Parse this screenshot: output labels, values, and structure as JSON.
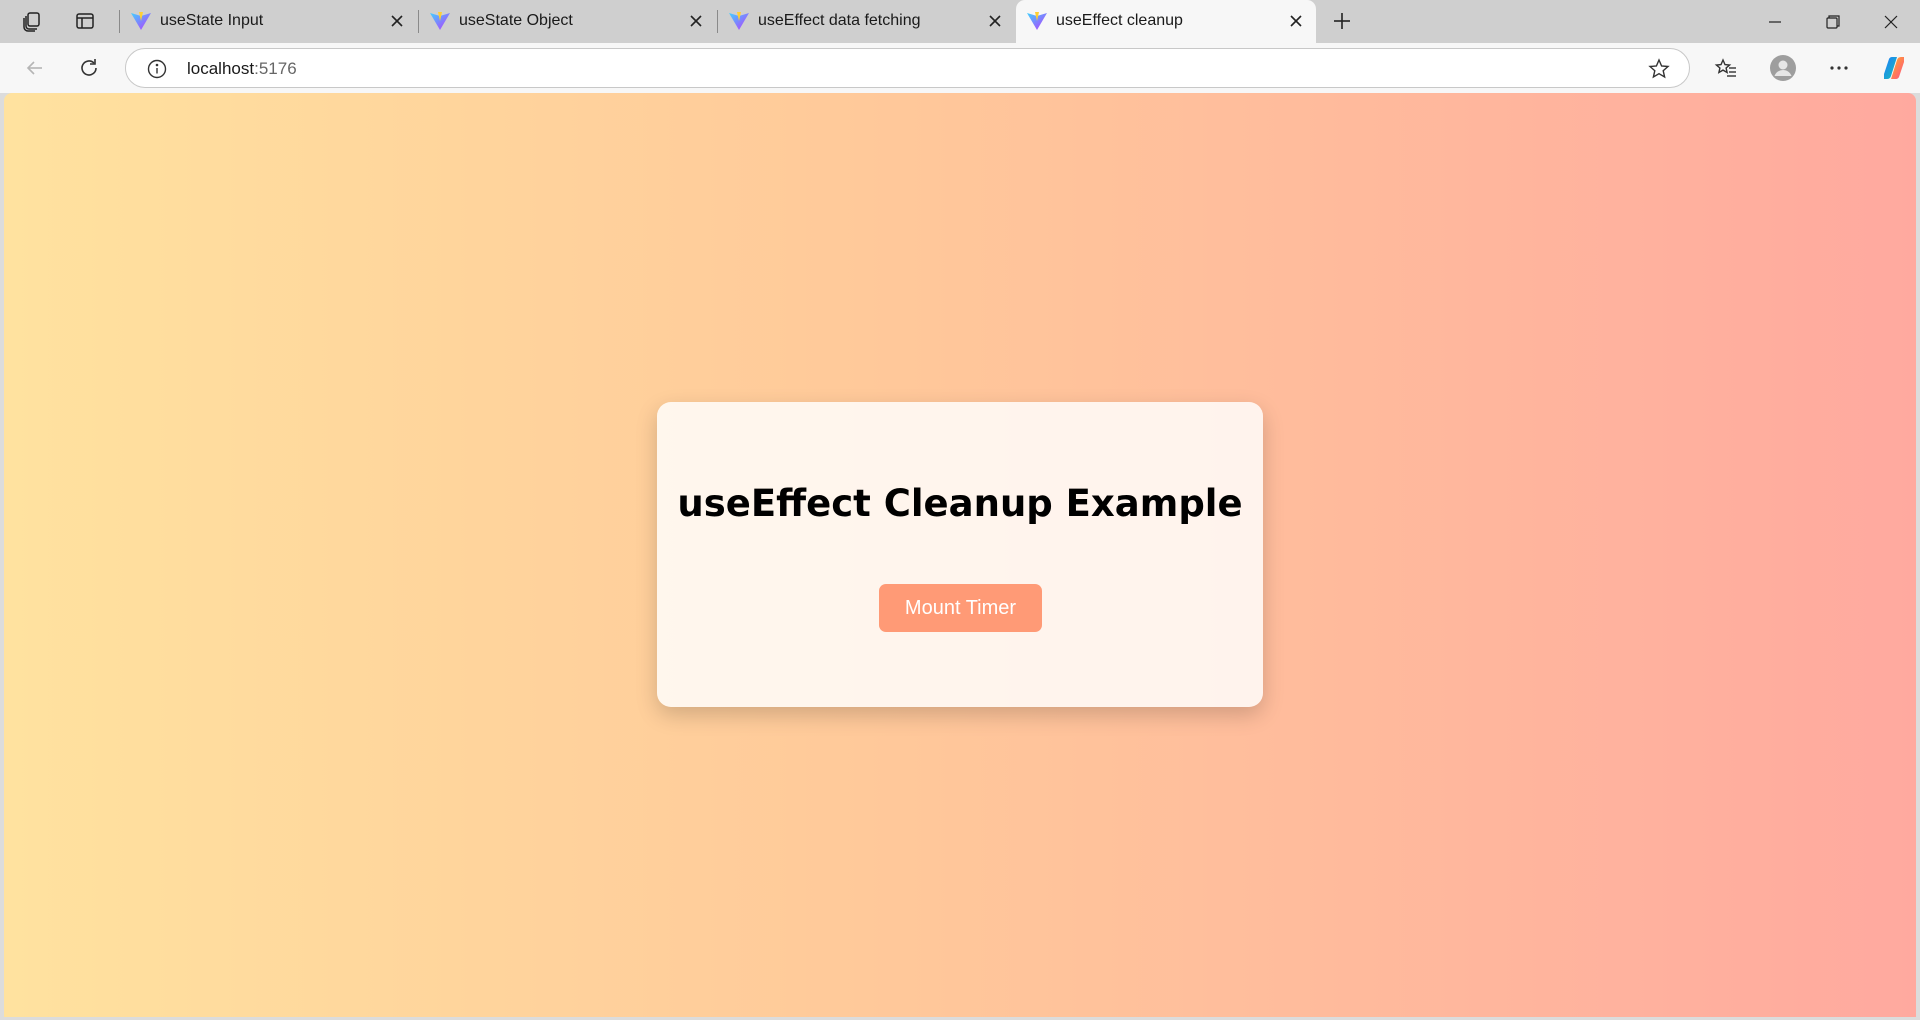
{
  "browser": {
    "tabs": [
      {
        "label": "useState Input",
        "active": false
      },
      {
        "label": "useState Object",
        "active": false
      },
      {
        "label": "useEffect data fetching",
        "active": false
      },
      {
        "label": "useEffect cleanup",
        "active": true
      }
    ],
    "address": {
      "host": "localhost",
      "port": ":5176"
    }
  },
  "page": {
    "heading": "useEffect Cleanup Example",
    "mount_button_label": "Mount Timer"
  },
  "colors": {
    "gradient_start": "#ffe29f",
    "gradient_end": "#ffa99f",
    "button_bg": "#ff9a76",
    "button_text": "#ffffff"
  },
  "icons": [
    "workspaces-icon",
    "tab-actions-icon",
    "vite-favicon-icon",
    "close-icon",
    "new-tab-icon",
    "minimize-icon",
    "restore-icon",
    "window-close-icon",
    "back-icon",
    "refresh-icon",
    "info-icon",
    "star-icon",
    "favorites-icon",
    "profile-icon",
    "more-icon",
    "copilot-icon"
  ]
}
